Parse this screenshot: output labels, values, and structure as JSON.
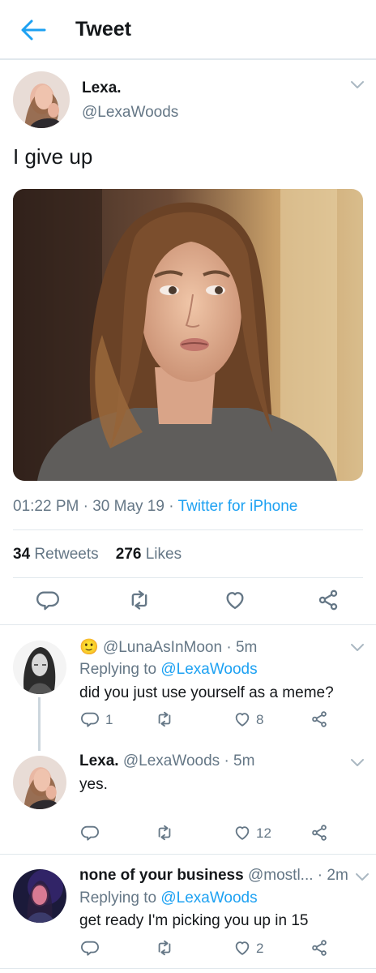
{
  "header": {
    "title": "Tweet"
  },
  "tweet": {
    "name": "Lexa.",
    "handle": "@LexaWoods",
    "text": "I give up",
    "time": "01:22 PM",
    "date": "30 May 19",
    "source": "Twitter for iPhone",
    "retweets_count": "34",
    "retweets_label": "Retweets",
    "likes_count": "276",
    "likes_label": "Likes"
  },
  "replies": [
    {
      "emoji": "🙂",
      "handle": "@LunaAsInMoon",
      "time": "5m",
      "replying_label": "Replying to",
      "replying_to": "@LexaWoods",
      "text": "did you just use yourself as a meme?",
      "reply_count": "1",
      "like_count": "8"
    },
    {
      "name": "Lexa.",
      "handle": "@LexaWoods",
      "time": "5m",
      "text": "yes.",
      "like_count": "12"
    },
    {
      "name": "none of your business",
      "handle": "@mostl...",
      "time": "2m",
      "replying_label": "Replying to",
      "replying_to": "@LexaWoods",
      "text": "get ready I'm picking you up in 15",
      "like_count": "2"
    }
  ],
  "colors": {
    "accent": "#1da1f2",
    "secondary_text": "#657786",
    "divider": "#e1e8ed"
  }
}
